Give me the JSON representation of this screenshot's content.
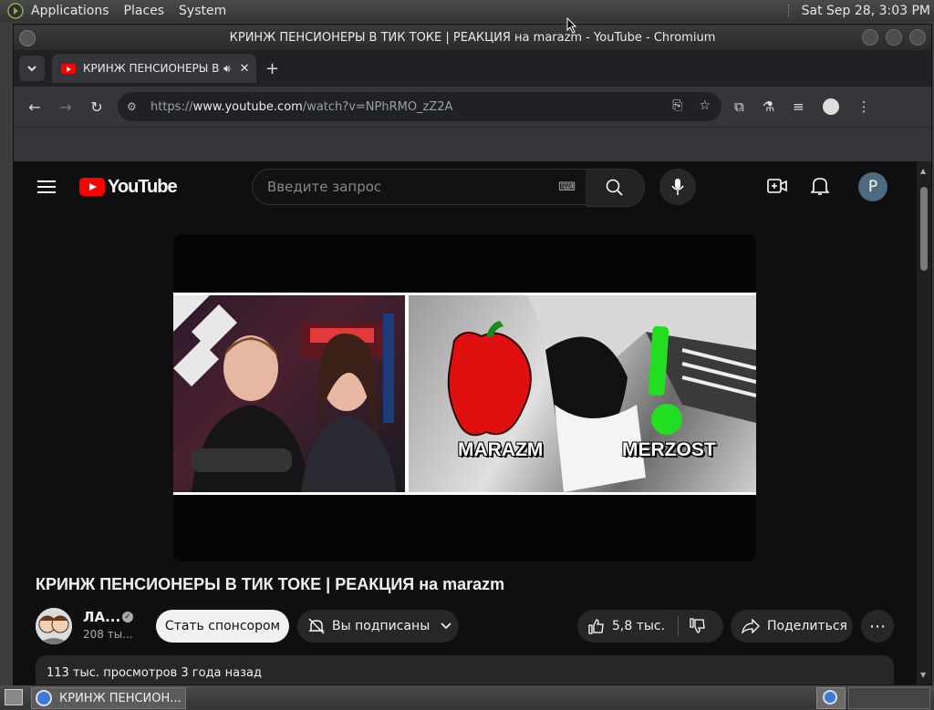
{
  "system_bar": {
    "menus": [
      "Applications",
      "Places",
      "System"
    ],
    "datetime": "Sat Sep 28,  3:03 PM"
  },
  "window": {
    "title": "КРИНЖ ПЕНСИОНЕРЫ В ТИК ТОКЕ | РЕАКЦИЯ на marazm - YouTube - Chromium"
  },
  "tab": {
    "title": "КРИНЖ ПЕНСИОНЕРЫ В ТИК ТОКЕ | РЕАКЦИЯ на marazm"
  },
  "address_bar": {
    "url_prefix": "https://",
    "url_host": "www.youtube.com",
    "url_path": "/watch?v=NPhRMO_zZ2A"
  },
  "youtube": {
    "logo_text": "YouTube",
    "search_placeholder": "Введите запрос",
    "avatar_letter": "P"
  },
  "video": {
    "title": "КРИНЖ ПЕНСИОНЕРЫ В ТИК ТОКЕ | РЕАКЦИЯ на marazm",
    "left_label": "MARAZM",
    "right_label": "MERZOST",
    "channel_name": "ЛА...",
    "subscribers": "208 ты...",
    "sponsor_label": "Стать спонсором",
    "subscribed_label": "Вы подписаны",
    "likes": "5,8 тыс.",
    "share_label": "Поделиться",
    "description": "113 тыс. просмотров  3 года назад"
  },
  "taskbar": {
    "task_title": "КРИНЖ ПЕНСИОН..."
  },
  "colors": {
    "yt_red": "#ff0000",
    "page_bg": "#0f0f0f",
    "pepper_red": "#e01010",
    "exclaim_green": "#22dd22"
  }
}
